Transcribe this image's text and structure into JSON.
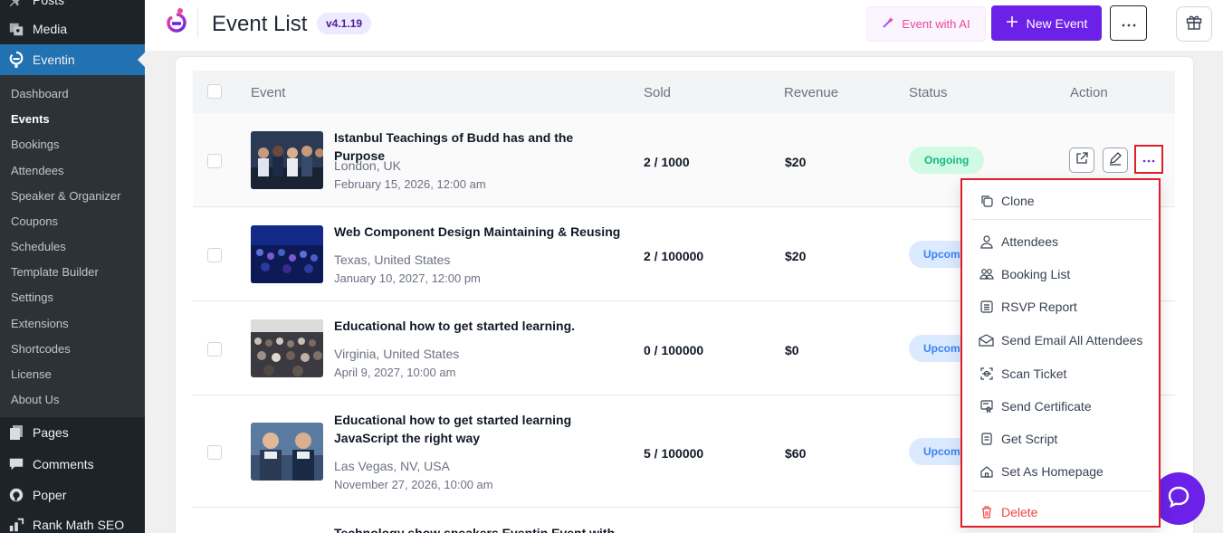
{
  "sidebar": {
    "top_items": [
      {
        "label": "Posts",
        "icon": "pin-icon"
      },
      {
        "label": "Media",
        "icon": "media-icon"
      },
      {
        "label": "Eventin",
        "icon": "eventin-logo-icon"
      }
    ],
    "submenu": [
      "Dashboard",
      "Events",
      "Bookings",
      "Attendees",
      "Speaker & Organizer",
      "Coupons",
      "Schedules",
      "Template Builder",
      "Settings",
      "Extensions",
      "Shortcodes",
      "License",
      "About Us"
    ],
    "current_submenu": "Events",
    "bottom_items": [
      {
        "label": "Pages",
        "icon": "pages-icon"
      },
      {
        "label": "Comments",
        "icon": "comments-icon"
      },
      {
        "label": "Poper",
        "icon": "poper-icon"
      },
      {
        "label": "Rank Math SEO",
        "icon": "rank-math-icon"
      }
    ]
  },
  "header": {
    "title": "Event List",
    "version": "v4.1.19",
    "ai_button": "Event with AI",
    "new_button": "New Event"
  },
  "table": {
    "columns": [
      "Event",
      "Sold",
      "Revenue",
      "Status",
      "Action"
    ],
    "rows": [
      {
        "title": "Istanbul Teachings of Budd has and the Purpose",
        "location": "London, UK",
        "date": "February 15, 2026, 12:00 am",
        "sold": "2 / 1000",
        "revenue": "$20",
        "status": "Ongoing"
      },
      {
        "title": "Web Component Design Maintaining & Reusing",
        "location": "Texas, United States",
        "date": "January 10, 2027, 12:00 pm",
        "sold": "2 / 100000",
        "revenue": "$20",
        "status": "Upcoming"
      },
      {
        "title": "Educational how to get started learning.",
        "location": "Virginia, United States",
        "date": "April 9, 2027, 10:00 am",
        "sold": "0 / 100000",
        "revenue": "$0",
        "status": "Upcoming"
      },
      {
        "title": "Educational how to get started learning JavaScript the right way",
        "location": "Las Vegas, NV, USA",
        "date": "November 27, 2026, 10:00 am",
        "sold": "5 / 100000",
        "revenue": "$60",
        "status": "Upcoming"
      },
      {
        "title": "Technology show speakers Eventin Event with",
        "location": "",
        "date": "",
        "sold": "",
        "revenue": "",
        "status": ""
      }
    ]
  },
  "dropdown": {
    "items": [
      {
        "label": "Clone",
        "icon": "copy-icon"
      },
      {
        "label": "Attendees",
        "icon": "user-icon"
      },
      {
        "label": "Booking List",
        "icon": "users-icon"
      },
      {
        "label": "RSVP Report",
        "icon": "list-icon"
      },
      {
        "label": "Send Email All Attendees",
        "icon": "mail-icon"
      },
      {
        "label": "Scan Ticket",
        "icon": "scan-icon"
      },
      {
        "label": "Send Certificate",
        "icon": "certificate-icon"
      },
      {
        "label": "Get Script",
        "icon": "script-icon"
      },
      {
        "label": "Set As Homepage",
        "icon": "home-icon"
      },
      {
        "label": "Delete",
        "icon": "trash-icon"
      }
    ]
  },
  "colors": {
    "accent": "#6b21e8",
    "wp_sidebar": "#1d2327",
    "wp_active": "#2271b1",
    "ongoing": "#10b981",
    "upcoming": "#3b82f6",
    "danger": "#ef4444",
    "highlight": "#e11d2a"
  }
}
